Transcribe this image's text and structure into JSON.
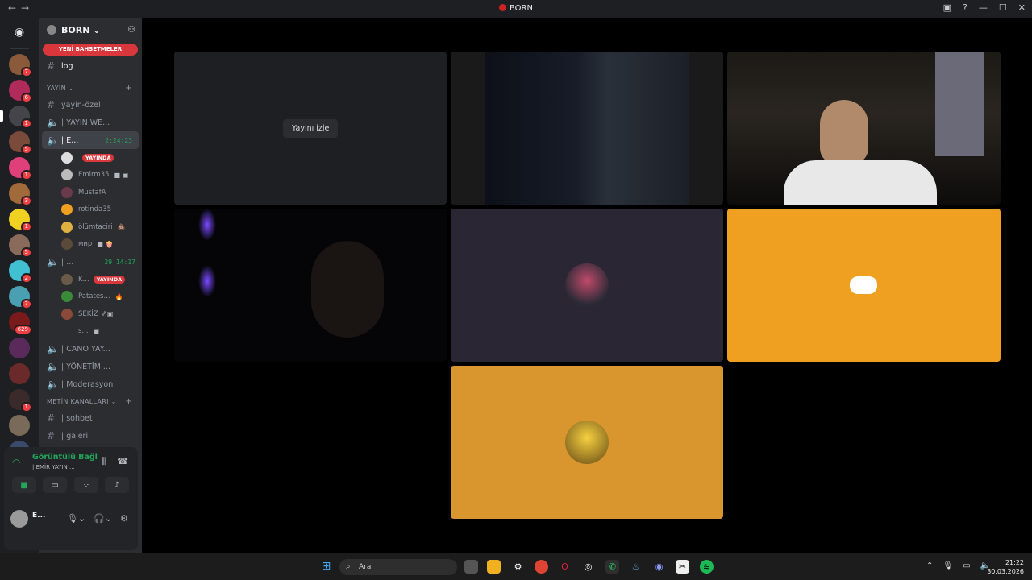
{
  "window": {
    "title": "BORN"
  },
  "server": {
    "name": "BORN"
  },
  "mention_bar": "YENİ BAHSETMELER",
  "top_channel": "log",
  "categories": {
    "stream": "YAYIN",
    "text": "METİN KANALLARI"
  },
  "channels": {
    "yayin_ozel": "yayin-özel",
    "yayin_we": "| YAYIN WE...",
    "active_voice": "| E...",
    "active_timer": "2:24:23",
    "second_voice": "| ...",
    "second_timer": "29:14:17",
    "cano": "| CANO YAY...",
    "yonetim": "| YÖNETİM ...",
    "moderasyon": "| Moderasyon",
    "sohbet": "| sohbet",
    "galeri": "| galeri"
  },
  "voice_users_1": [
    {
      "name": "",
      "live": "YAYINDA"
    },
    {
      "name": "Emirm35",
      "live": ""
    },
    {
      "name": "MustafA",
      "live": ""
    },
    {
      "name": "rotinda35",
      "live": ""
    },
    {
      "name": "ölümtaciri",
      "live": ""
    },
    {
      "name": "мир",
      "live": ""
    }
  ],
  "voice_users_2": [
    {
      "name": "K...",
      "live": "YAYINDA"
    },
    {
      "name": "Patates...",
      "live": ""
    },
    {
      "name": "SEKİZ",
      "live": ""
    },
    {
      "name": "s...",
      "live": ""
    }
  ],
  "guild_badges": [
    "7",
    "6",
    "1",
    "5",
    "1",
    "3",
    "1",
    "5",
    "2",
    "2",
    "629",
    "",
    "",
    "1",
    "",
    ""
  ],
  "voice_panel": {
    "status": "Görüntülü Bağl",
    "channel": "| EMİR YAYIN ...",
    "user": "E..."
  },
  "stage": {
    "watch_button": "Yayını izle"
  },
  "taskbar": {
    "search_placeholder": "Ara",
    "time": "21:22",
    "date": "30.03.2026"
  },
  "colors": {
    "accent_green": "#23a55a",
    "live_red": "#da373c",
    "tile_orange": "#f0a020",
    "tile_orange2": "#d9962e",
    "tile_purple": "#2b2633"
  }
}
